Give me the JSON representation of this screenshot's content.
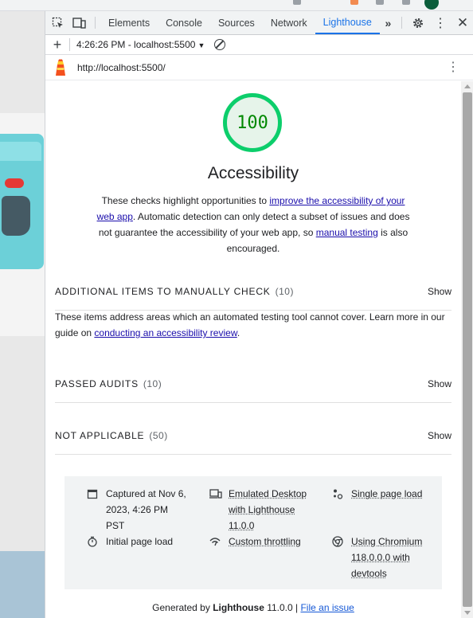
{
  "devtools": {
    "tabs": [
      "Elements",
      "Console",
      "Sources",
      "Network",
      "Lighthouse"
    ],
    "active_tab": "Lighthouse"
  },
  "lighthouse_toolbar": {
    "report_select": "4:26:26 PM - localhost:5500"
  },
  "url_bar": {
    "url": "http://localhost:5500/"
  },
  "report": {
    "score": "100",
    "category_title": "Accessibility",
    "description": {
      "part1": "These checks highlight opportunities to ",
      "link1": "improve the accessibility of your web app",
      "part2": ". Automatic detection can only detect a subset of issues and does not guarantee the accessibility of your web app, so ",
      "link2": "manual testing",
      "part3": " is also encouraged."
    },
    "groups": [
      {
        "title": "ADDITIONAL ITEMS TO MANUALLY CHECK",
        "count": "(10)",
        "action": "Show"
      },
      {
        "title": "PASSED AUDITS",
        "count": "(10)",
        "action": "Show"
      },
      {
        "title": "NOT APPLICABLE",
        "count": "(50)",
        "action": "Show"
      }
    ],
    "manual_desc": {
      "text": "These items address areas which an automated testing tool cannot cover. Learn more in our guide on ",
      "link": "conducting an accessibility review",
      "end": "."
    },
    "meta": {
      "captured": "Captured at Nov 6, 2023, 4:26 PM PST",
      "emulated": "Emulated Desktop with Lighthouse 11.0.0",
      "single_load": "Single page load",
      "initial_load": "Initial page load",
      "throttling": "Custom throttling",
      "chromium": "Using Chromium 118.0.0.0 with devtools"
    },
    "footer": {
      "prefix": "Generated by ",
      "brand": "Lighthouse",
      "version": " 11.0.0 | ",
      "issue_link": "File an issue"
    }
  },
  "colors": {
    "score_green": "#0cce6b",
    "score_text": "#008800",
    "active_tab": "#1a73e8"
  }
}
